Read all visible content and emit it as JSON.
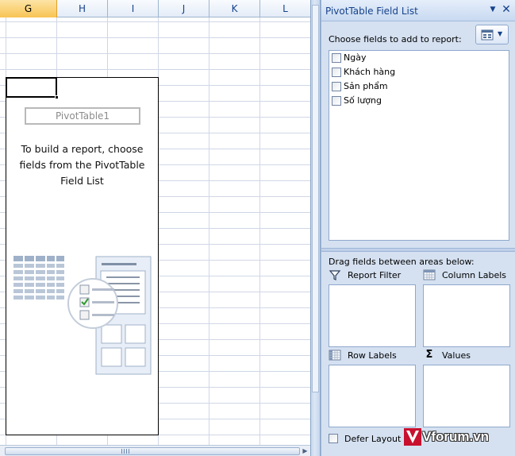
{
  "sheet": {
    "columns": [
      {
        "label": "G",
        "active": true
      },
      {
        "label": "H",
        "active": false
      },
      {
        "label": "I",
        "active": false
      },
      {
        "label": "J",
        "active": false
      },
      {
        "label": "K",
        "active": false
      },
      {
        "label": "L",
        "active": false
      }
    ],
    "pivot_name": "PivotTable1",
    "pivot_message": "To build a report, choose fields from the PivotTable Field List"
  },
  "pane": {
    "title": "PivotTable Field List",
    "menu_icon": "dropdown-arrow-icon",
    "close_icon": "close-icon",
    "choose_label": "Choose fields to add to report:",
    "fields": [
      {
        "label": "Ngày",
        "checked": false
      },
      {
        "label": "Khách hàng",
        "checked": false
      },
      {
        "label": "Sản phẩm",
        "checked": false
      },
      {
        "label": "Số lượng",
        "checked": false
      }
    ],
    "drag_label": "Drag fields between areas below:",
    "areas": {
      "report_filter": "Report Filter",
      "column_labels": "Column Labels",
      "row_labels": "Row Labels",
      "values": "Values"
    },
    "defer_label": "Defer Layout Update"
  },
  "watermark": {
    "text": "Vforum.vn"
  },
  "colors": {
    "accent": "#15428b",
    "pane_bg": "#d5e1f1",
    "grid_line": "#d0d7e5",
    "header_active": "#f8c454"
  }
}
